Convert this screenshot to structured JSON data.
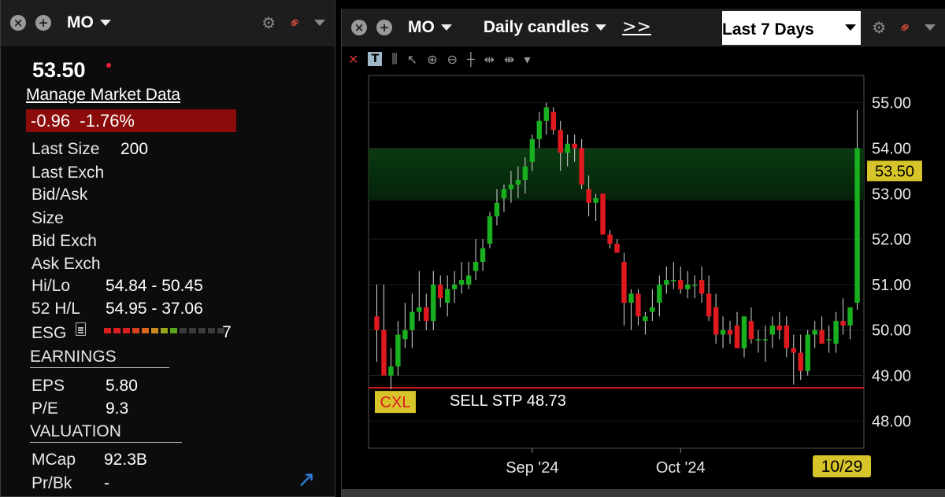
{
  "quote": {
    "symbol": "MO",
    "price": "53.50",
    "manage_link": "Manage Market Data",
    "change": "-0.96",
    "change_pct": "-1.76%",
    "labels": {
      "last_size": "Last Size",
      "last_exch": "Last Exch",
      "bid_ask": "Bid/Ask",
      "size": "Size",
      "bid_exch": "Bid Exch",
      "ask_exch": "Ask Exch",
      "hi_lo": "Hi/Lo",
      "h52": "52 H/L",
      "esg": "ESG",
      "earnings": "EARNINGS",
      "eps": "EPS",
      "pe": "P/E",
      "valuation": "VALUATION",
      "mcap": "MCap",
      "prbk": "Pr/Bk"
    },
    "values": {
      "last_size": "200",
      "hi_lo": "54.84 - 50.45",
      "h52": "54.95 - 37.06",
      "esg": "7",
      "eps": "5.80",
      "pe": "9.3",
      "mcap": "92.3B",
      "prbk": "-"
    },
    "esg_colors": [
      "#d81e1e",
      "#d81e1e",
      "#d81e1e",
      "#d8421e",
      "#d8661e",
      "#c98a1e",
      "#9aa61e",
      "#57a61e",
      "#3a3a3a",
      "#3a3a3a",
      "#3a3a3a",
      "#3a3a3a",
      "#3a3a3a"
    ]
  },
  "chart_window": {
    "symbol": "MO",
    "period": "Daily candles",
    "chevrons": ">>",
    "range": "Last 7 Days",
    "order_cancel": "CXL",
    "order_label": "SELL STP 48.73",
    "last_price_tag": "53.50",
    "date_tag": "10/29"
  },
  "colors": {
    "up": "#19b01f",
    "down": "#e0191f",
    "order_line": "#e0191f",
    "cxl_bg": "#d6c42a",
    "cxl_text": "#e0191f",
    "price_tag": "#d6c42a"
  },
  "chart_data": {
    "type": "candlestick",
    "y_ticks": [
      "55.00",
      "54.00",
      "53.00",
      "52.00",
      "51.00",
      "50.00",
      "49.00",
      "48.00"
    ],
    "ylim": [
      47.4,
      55.6
    ],
    "x_ticks": [
      {
        "index": 22,
        "label": "Sep '24"
      },
      {
        "index": 43,
        "label": "Oct '24"
      }
    ],
    "shaded_band": [
      52.85,
      54.0
    ],
    "stop_order": 48.73,
    "candles": [
      [
        50.3,
        51.0,
        49.3,
        50.0
      ],
      [
        50.0,
        51.0,
        49.2,
        49.0
      ],
      [
        49.0,
        49.6,
        48.7,
        49.2
      ],
      [
        49.2,
        50.2,
        49.0,
        49.9
      ],
      [
        49.8,
        50.6,
        49.6,
        50.0
      ],
      [
        50.0,
        50.8,
        49.6,
        50.4
      ],
      [
        50.4,
        51.3,
        50.2,
        50.5
      ],
      [
        50.5,
        50.8,
        50.0,
        50.2
      ],
      [
        50.2,
        51.3,
        50.0,
        51.0
      ],
      [
        51.0,
        51.2,
        50.5,
        50.7
      ],
      [
        50.6,
        51.2,
        50.3,
        50.9
      ],
      [
        50.9,
        51.3,
        50.6,
        51.0
      ],
      [
        51.0,
        51.5,
        50.8,
        51.1
      ],
      [
        51.0,
        51.5,
        50.9,
        51.2
      ],
      [
        51.3,
        52.0,
        51.1,
        51.5
      ],
      [
        51.5,
        52.0,
        51.3,
        51.8
      ],
      [
        51.9,
        52.6,
        51.8,
        52.5
      ],
      [
        52.5,
        53.1,
        52.3,
        52.8
      ],
      [
        52.9,
        53.2,
        52.6,
        53.1
      ],
      [
        53.1,
        53.5,
        52.8,
        53.2
      ],
      [
        53.2,
        53.6,
        52.9,
        53.3
      ],
      [
        53.3,
        53.8,
        53.0,
        53.6
      ],
      [
        53.7,
        54.3,
        53.5,
        54.2
      ],
      [
        54.2,
        54.8,
        54.0,
        54.6
      ],
      [
        54.6,
        55.0,
        54.3,
        54.9
      ],
      [
        54.8,
        54.9,
        54.3,
        54.4
      ],
      [
        54.4,
        54.6,
        53.5,
        53.9
      ],
      [
        53.9,
        54.3,
        53.6,
        54.1
      ],
      [
        54.1,
        54.3,
        53.7,
        54.0
      ],
      [
        54.0,
        54.2,
        53.1,
        53.2
      ],
      [
        53.1,
        53.4,
        52.5,
        52.8
      ],
      [
        52.8,
        53.0,
        52.4,
        52.9
      ],
      [
        53.0,
        53.0,
        52.1,
        52.1
      ],
      [
        52.1,
        52.2,
        51.8,
        51.9
      ],
      [
        51.9,
        52.0,
        51.7,
        51.7
      ],
      [
        51.5,
        51.7,
        50.1,
        50.6
      ],
      [
        50.6,
        50.9,
        50.0,
        50.8
      ],
      [
        50.8,
        50.9,
        50.1,
        50.3
      ],
      [
        50.2,
        50.4,
        49.9,
        50.3
      ],
      [
        50.4,
        50.9,
        50.2,
        50.5
      ],
      [
        50.6,
        51.2,
        50.3,
        51.0
      ],
      [
        51.0,
        51.4,
        50.8,
        51.1
      ],
      [
        51.1,
        51.5,
        50.9,
        51.1
      ],
      [
        51.1,
        51.4,
        50.8,
        50.9
      ],
      [
        50.9,
        51.3,
        50.7,
        51.0
      ],
      [
        51.0,
        51.2,
        50.7,
        51.0
      ],
      [
        51.1,
        51.4,
        50.6,
        50.8
      ],
      [
        50.8,
        51.2,
        50.2,
        50.3
      ],
      [
        50.5,
        50.8,
        49.7,
        49.9
      ],
      [
        49.9,
        50.3,
        49.6,
        50.0
      ],
      [
        50.0,
        50.2,
        49.7,
        49.9
      ],
      [
        50.1,
        50.4,
        49.6,
        49.6
      ],
      [
        49.6,
        50.3,
        49.4,
        50.3
      ],
      [
        50.2,
        50.5,
        49.7,
        49.8
      ],
      [
        49.8,
        50.0,
        49.5,
        49.8
      ],
      [
        49.8,
        50.1,
        49.3,
        49.8
      ],
      [
        49.9,
        50.3,
        49.6,
        50.1
      ],
      [
        50.1,
        50.4,
        49.8,
        50.0
      ],
      [
        50.1,
        50.3,
        49.4,
        49.6
      ],
      [
        49.6,
        49.9,
        48.8,
        49.5
      ],
      [
        49.5,
        49.9,
        48.9,
        49.1
      ],
      [
        49.1,
        50.0,
        49.0,
        49.9
      ],
      [
        49.9,
        50.2,
        49.6,
        50.0
      ],
      [
        50.0,
        50.3,
        49.7,
        49.7
      ],
      [
        49.8,
        50.1,
        49.5,
        49.8
      ],
      [
        49.7,
        50.4,
        49.5,
        50.2
      ],
      [
        50.2,
        50.7,
        49.9,
        50.1
      ],
      [
        50.1,
        50.4,
        49.8,
        50.5
      ],
      [
        50.6,
        54.84,
        50.45,
        54.0
      ]
    ]
  }
}
